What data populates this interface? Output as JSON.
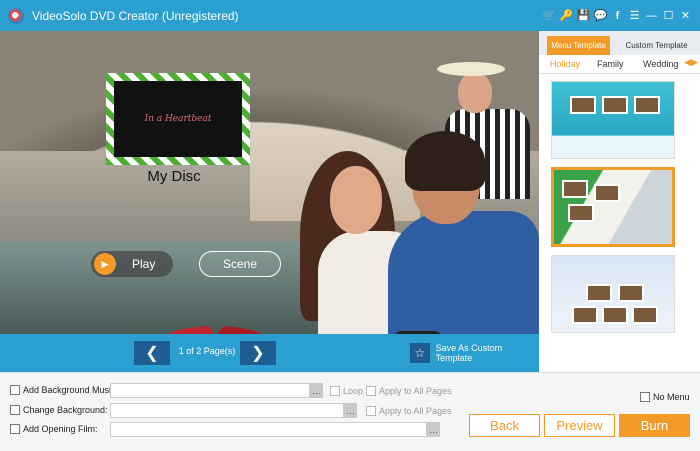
{
  "window": {
    "title": "VideoSolo DVD Creator (Unregistered)",
    "icons": [
      "cart-icon",
      "key-icon",
      "save-icon",
      "chat-icon",
      "facebook-icon",
      "menu-icon",
      "minimize-icon",
      "maximize-icon",
      "close-icon"
    ]
  },
  "menu": {
    "thumbnail_text": "In a Heartbeat",
    "disc_title": "My Disc",
    "play_label": "Play",
    "scene_label": "Scene"
  },
  "pager": {
    "prev": "❮",
    "next": "❯",
    "page_info": "1 of 2 Page(s)",
    "save_template": "Save As Custom Template"
  },
  "panel": {
    "tabs": [
      {
        "label": "Menu Template",
        "active": true
      },
      {
        "label": "Custom Template",
        "active": false
      }
    ],
    "categories": [
      {
        "label": "Holiday",
        "active": true
      },
      {
        "label": "Family"
      },
      {
        "label": "Wedding"
      }
    ],
    "templates": [
      {
        "name": "template-1"
      },
      {
        "name": "template-2",
        "selected": true
      },
      {
        "name": "template-3"
      }
    ]
  },
  "bottom": {
    "bg_music_label": "Add Background Music:",
    "change_bg_label": "Change Background:",
    "opening_film_label": "Add Opening Film:",
    "loop_label": "Loop",
    "apply_all_1": "Apply to All Pages",
    "apply_all_2": "Apply to All Pages",
    "no_menu_label": "No Menu",
    "back": "Back",
    "preview": "Preview",
    "burn": "Burn",
    "browse": "…"
  },
  "colors": {
    "accent": "#f49a27",
    "header": "#2b9fd0",
    "nav_dark": "#1f5e93"
  }
}
